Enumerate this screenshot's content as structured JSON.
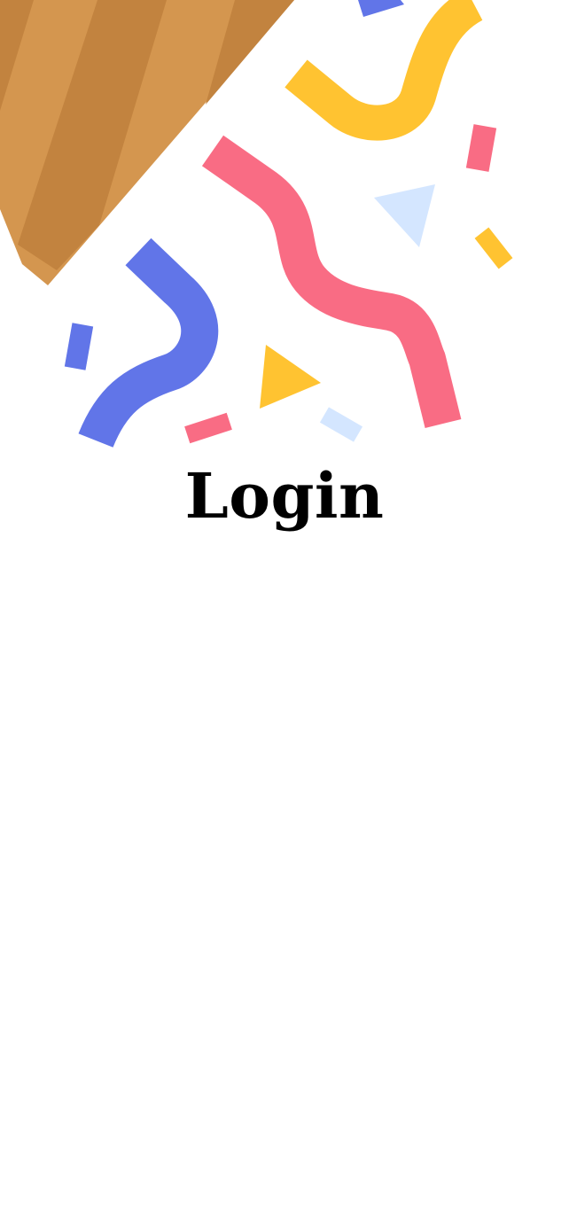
{
  "screen": {
    "title": "Login"
  },
  "illustration": {
    "icon": "party-popper-icon",
    "colors": {
      "cone_light": "#D4964F",
      "cone_dark": "#C2833F",
      "blue": "#6175E8",
      "yellow": "#FFC331",
      "pink": "#F96C84",
      "light_blue": "#D4E6FF"
    }
  }
}
